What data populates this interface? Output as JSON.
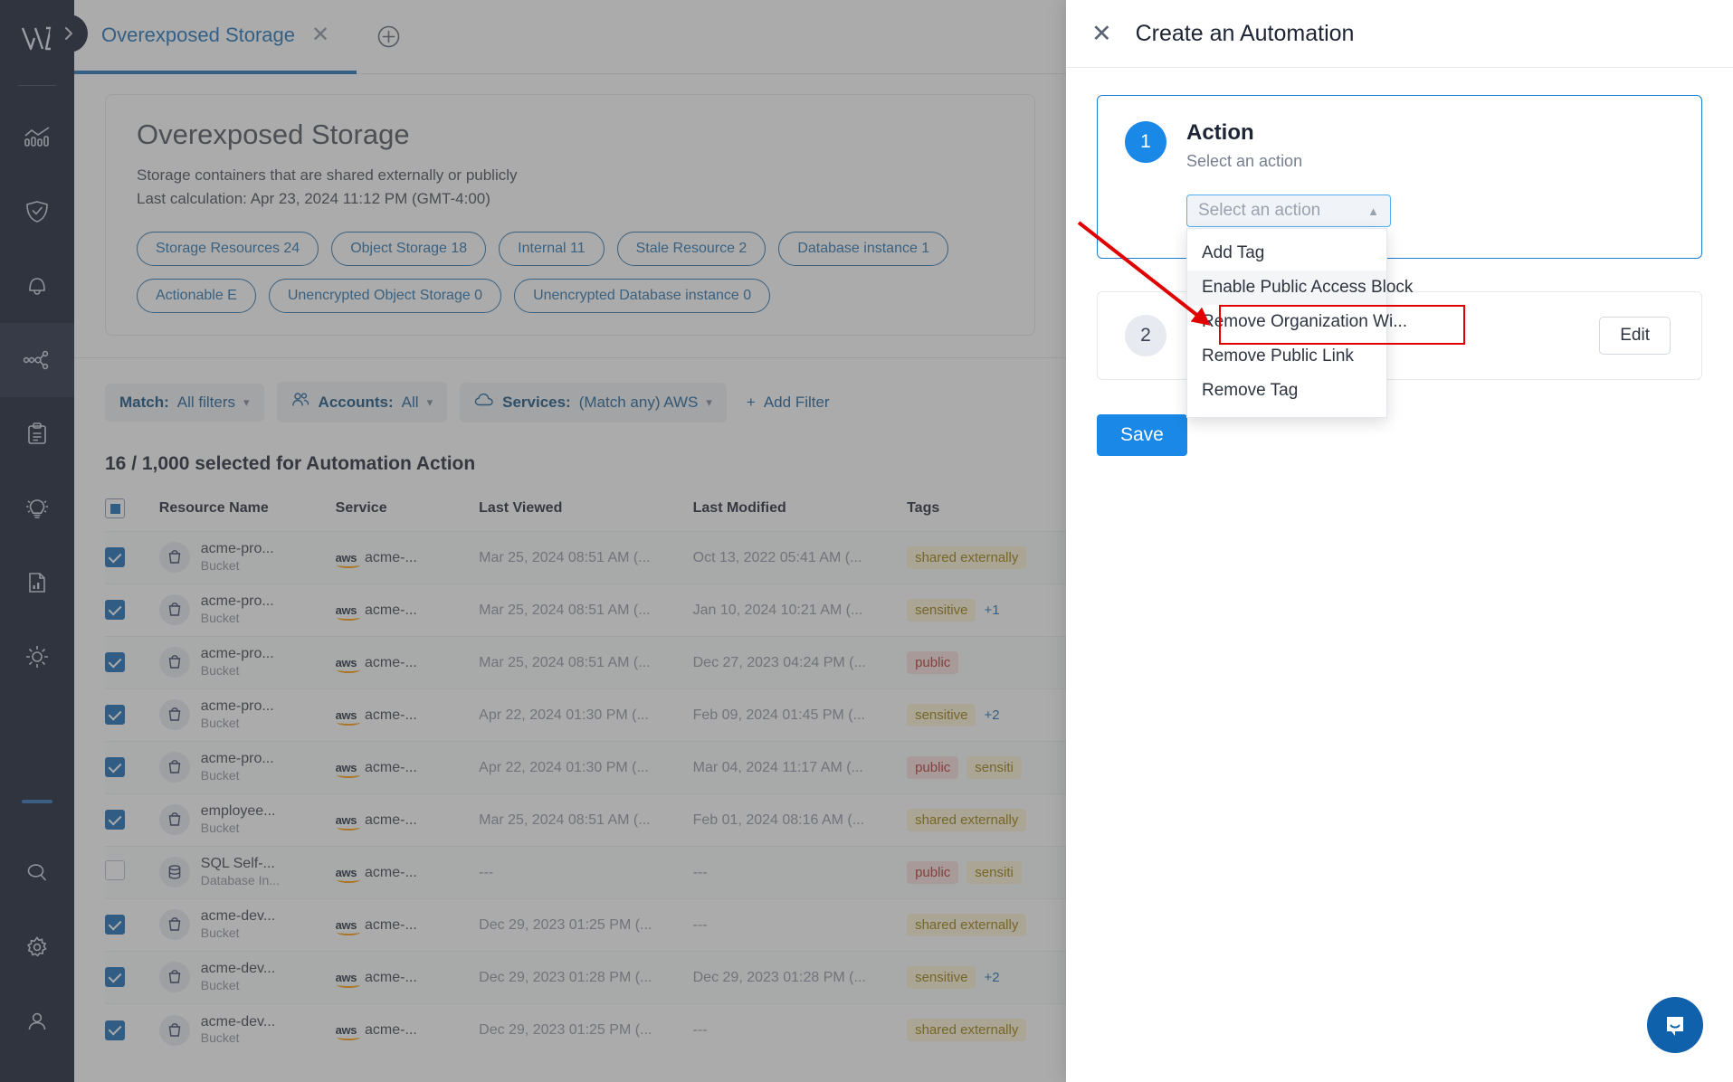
{
  "sidebar": {
    "logo_name": "wiz-logo",
    "expand_icon": "chevron-right-icon",
    "items": [
      {
        "name": "analytics",
        "icon": "bar-chart-icon",
        "active": false
      },
      {
        "name": "security",
        "icon": "shield-check-icon",
        "active": false
      },
      {
        "name": "alerts",
        "icon": "bell-icon",
        "active": false
      },
      {
        "name": "graph",
        "icon": "network-graph-icon",
        "active": true
      },
      {
        "name": "projects",
        "icon": "clipboard-icon",
        "active": false
      },
      {
        "name": "insights",
        "icon": "lightbulb-icon",
        "active": false
      },
      {
        "name": "reports",
        "icon": "document-chart-icon",
        "active": false
      },
      {
        "name": "explore",
        "icon": "sun-icon",
        "active": false
      }
    ],
    "bottom_items": [
      {
        "name": "search",
        "icon": "search-icon"
      },
      {
        "name": "settings",
        "icon": "gear-icon"
      },
      {
        "name": "account",
        "icon": "user-icon"
      }
    ]
  },
  "tabbar": {
    "tab_label": "Overexposed Storage",
    "close_icon": "close-icon",
    "add_icon": "plus-circle-icon"
  },
  "page": {
    "title": "Overexposed Storage",
    "description": "Storage containers that are shared externally or publicly",
    "last_calculation": "Last calculation: Apr 23, 2024 11:12 PM (GMT-4:00)",
    "chips": [
      "Storage Resources 24",
      "Object Storage 18",
      "Internal 11",
      "Stale Resource 2",
      "Database instance 1",
      "Actionable E",
      "Unencrypted Object Storage 0",
      "Unencrypted Database instance 0"
    ]
  },
  "filters": {
    "match": {
      "label": "Match:",
      "value": "All filters",
      "caret": "chevron-down-icon"
    },
    "accounts": {
      "icon": "users-icon",
      "label": "Accounts:",
      "value": "All",
      "caret": "chevron-down-icon"
    },
    "services": {
      "icon": "cloud-icon",
      "label": "Services:",
      "value": "(Match any) AWS",
      "caret": "chevron-down-icon"
    },
    "add_filter": {
      "icon": "plus-icon",
      "label": "Add Filter"
    }
  },
  "table": {
    "selection_summary": "16 / 1,000 selected for Automation Action",
    "columns": [
      "Resource Name",
      "Service",
      "Last Viewed",
      "Last Modified",
      "Tags"
    ],
    "header_checkbox_state": "indeterminate",
    "rows": [
      {
        "checked": true,
        "icon": "bucket-icon",
        "name": "acme-pro...",
        "type": "Bucket",
        "service_mark": "aws",
        "service": "acme-...",
        "last_viewed": "Mar 25, 2024 08:51 AM (...",
        "last_modified": "Oct 13, 2022 05:41 AM (...",
        "tags": [
          {
            "text": "shared externally",
            "color": "yellow"
          }
        ],
        "more": ""
      },
      {
        "checked": true,
        "icon": "bucket-icon",
        "name": "acme-pro...",
        "type": "Bucket",
        "service_mark": "aws",
        "service": "acme-...",
        "last_viewed": "Mar 25, 2024 08:51 AM (...",
        "last_modified": "Jan 10, 2024 10:21 AM (...",
        "tags": [
          {
            "text": "sensitive",
            "color": "yellow"
          }
        ],
        "more": "+1"
      },
      {
        "checked": true,
        "icon": "bucket-icon",
        "name": "acme-pro...",
        "type": "Bucket",
        "service_mark": "aws",
        "service": "acme-...",
        "last_viewed": "Mar 25, 2024 08:51 AM (...",
        "last_modified": "Dec 27, 2023 04:24 PM (...",
        "tags": [
          {
            "text": "public",
            "color": "red"
          }
        ],
        "more": ""
      },
      {
        "checked": true,
        "icon": "bucket-icon",
        "name": "acme-pro...",
        "type": "Bucket",
        "service_mark": "aws",
        "service": "acme-...",
        "last_viewed": "Apr 22, 2024 01:30 PM (...",
        "last_modified": "Feb 09, 2024 01:45 PM (...",
        "tags": [
          {
            "text": "sensitive",
            "color": "yellow"
          }
        ],
        "more": "+2"
      },
      {
        "checked": true,
        "icon": "bucket-icon",
        "name": "acme-pro...",
        "type": "Bucket",
        "service_mark": "aws",
        "service": "acme-...",
        "last_viewed": "Apr 22, 2024 01:30 PM (...",
        "last_modified": "Mar 04, 2024 11:17 AM (...",
        "tags": [
          {
            "text": "public",
            "color": "red"
          },
          {
            "text": "sensiti",
            "color": "yellow"
          }
        ],
        "more": ""
      },
      {
        "checked": true,
        "icon": "bucket-icon",
        "name": "employee...",
        "type": "Bucket",
        "service_mark": "aws",
        "service": "acme-...",
        "last_viewed": "Mar 25, 2024 08:51 AM (...",
        "last_modified": "Feb 01, 2024 08:16 AM (...",
        "tags": [
          {
            "text": "shared externally",
            "color": "yellow"
          }
        ],
        "more": ""
      },
      {
        "checked": false,
        "icon": "database-icon",
        "name": "SQL Self-...",
        "type": "Database In...",
        "service_mark": "aws",
        "service": "acme-...",
        "last_viewed": "---",
        "last_modified": "---",
        "tags": [
          {
            "text": "public",
            "color": "red"
          },
          {
            "text": "sensiti",
            "color": "yellow"
          }
        ],
        "more": ""
      },
      {
        "checked": true,
        "icon": "bucket-icon",
        "name": "acme-dev...",
        "type": "Bucket",
        "service_mark": "aws",
        "service": "acme-...",
        "last_viewed": "Dec 29, 2023 01:25 PM (...",
        "last_modified": "---",
        "tags": [
          {
            "text": "shared externally",
            "color": "yellow"
          }
        ],
        "more": ""
      },
      {
        "checked": true,
        "icon": "bucket-icon",
        "name": "acme-dev...",
        "type": "Bucket",
        "service_mark": "aws",
        "service": "acme-...",
        "last_viewed": "Dec 29, 2023 01:28 PM (...",
        "last_modified": "Dec 29, 2023 01:28 PM (...",
        "tags": [
          {
            "text": "sensitive",
            "color": "yellow"
          }
        ],
        "more": "+2"
      },
      {
        "checked": true,
        "icon": "bucket-icon",
        "name": "acme-dev...",
        "type": "Bucket",
        "service_mark": "aws",
        "service": "acme-...",
        "last_viewed": "Dec 29, 2023 01:25 PM (...",
        "last_modified": "---",
        "tags": [
          {
            "text": "shared externally",
            "color": "yellow"
          }
        ],
        "more": ""
      }
    ]
  },
  "drawer": {
    "close_icon": "close-icon",
    "title": "Create an Automation",
    "step1": {
      "number": "1",
      "title": "Action",
      "subtitle": "Select an action",
      "select_placeholder": "Select an action",
      "select_value": "",
      "chevron": "chevron-up-icon",
      "options": [
        "Add Tag",
        "Enable Public Access Block",
        "Remove Organization Wi...",
        "Remove Public Link",
        "Remove Tag"
      ],
      "highlighted_option": "Enable Public Access Block"
    },
    "step2": {
      "number": "2",
      "edit_label": "Edit"
    },
    "save_label": "Save"
  },
  "chat": {
    "icon": "chat-bubble-icon"
  },
  "colors": {
    "accent_blue": "#1a88e6",
    "link_blue": "#1a6fb5",
    "sidebar_bg": "#141c2e",
    "annotation_red": "#e10000",
    "tag_yellow_bg": "#fdf4d4",
    "tag_red_bg": "#fbdede"
  }
}
